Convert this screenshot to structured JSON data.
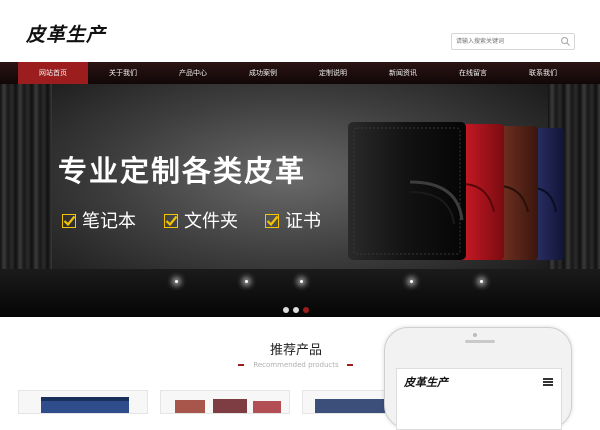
{
  "header": {
    "logo_text": "皮革生产",
    "search_placeholder": "请输入搜索关键词",
    "search_icon": "search-icon"
  },
  "nav": {
    "items": [
      {
        "label": "网站首页",
        "active": true
      },
      {
        "label": "关于我们",
        "active": false
      },
      {
        "label": "产品中心",
        "active": false
      },
      {
        "label": "成功案例",
        "active": false
      },
      {
        "label": "定制说明",
        "active": false
      },
      {
        "label": "新闻资讯",
        "active": false
      },
      {
        "label": "在线留言",
        "active": false
      },
      {
        "label": "联系我们",
        "active": false
      }
    ]
  },
  "banner": {
    "headline": "专业定制各类皮革",
    "features": [
      "笔记本",
      "文件夹",
      "证书"
    ],
    "check_icon": "yellow-check-icon",
    "slides_count": 3,
    "active_slide": 3,
    "product_colors": [
      "#1a1a1a",
      "#b3121c",
      "#5a2418",
      "#1f2350"
    ]
  },
  "products": {
    "title": "推荐产品",
    "subtitle": "Recommended products"
  },
  "mobile_preview": {
    "logo_text": "皮革生产",
    "menu_icon": "hamburger-menu-icon"
  },
  "colors": {
    "accent": "#9c1d1d",
    "nav_background": "#1e0d0d",
    "check_yellow": "#f5c400"
  }
}
